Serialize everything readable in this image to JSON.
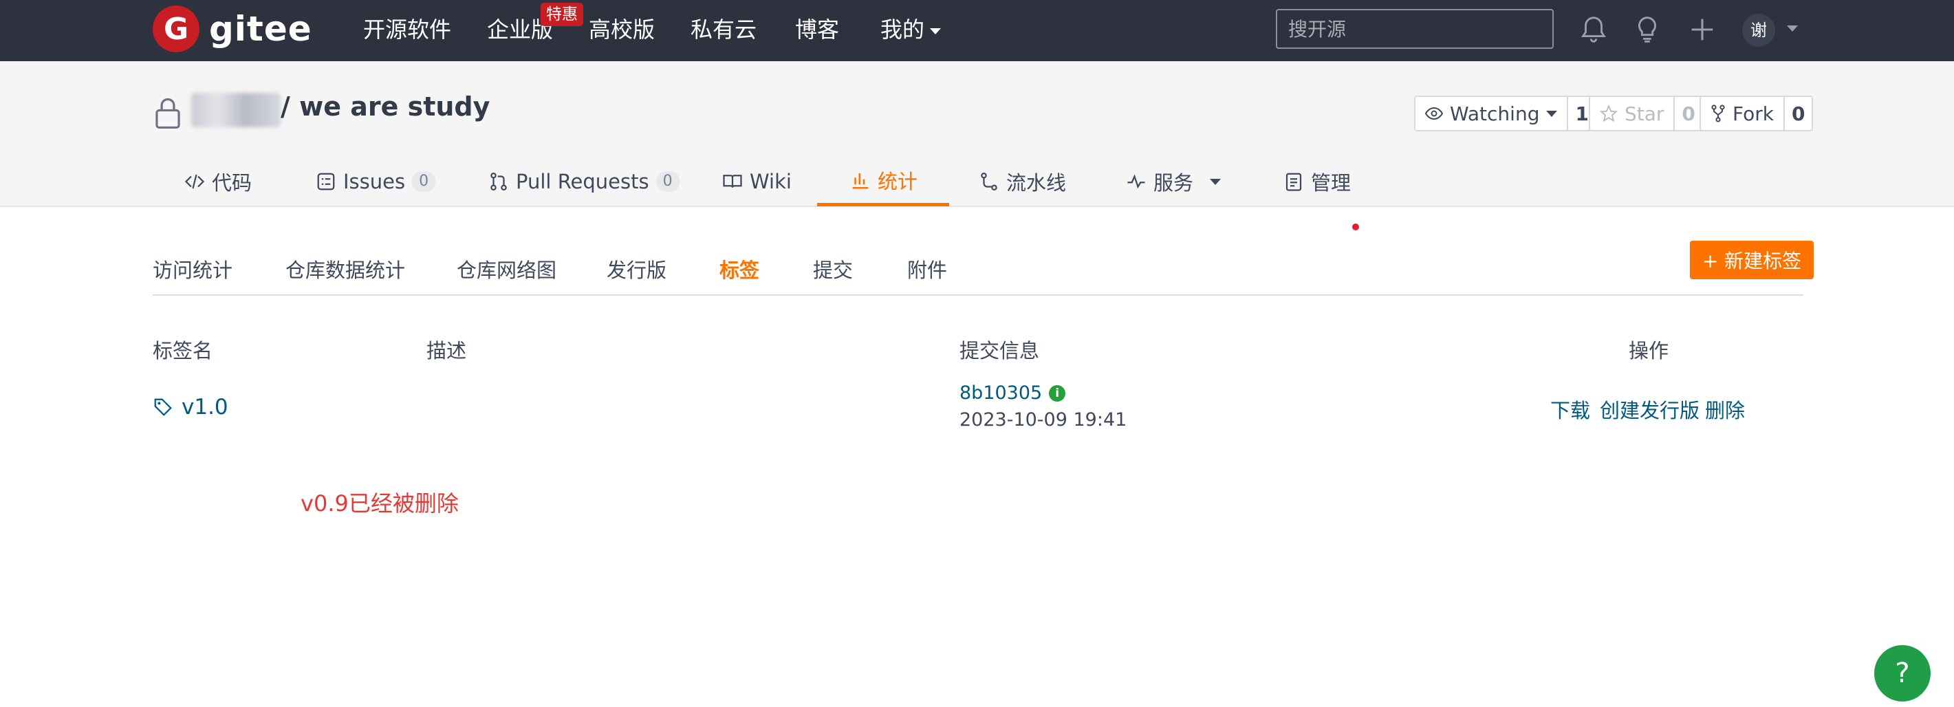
{
  "topnav": {
    "logo_text": "gitee",
    "items": [
      {
        "label": "开源软件"
      },
      {
        "label": "企业版",
        "badge": "特惠"
      },
      {
        "label": "高校版"
      },
      {
        "label": "私有云"
      },
      {
        "label": "博客"
      },
      {
        "label": "我的"
      }
    ],
    "search_placeholder": "搜开源",
    "avatar_initial": "谢",
    "icons": [
      "bell-icon",
      "lightbulb-icon",
      "plus-icon"
    ]
  },
  "repo": {
    "name": "/ we are study",
    "watch": {
      "label": "Watching",
      "count": "1"
    },
    "star": {
      "label": "Star",
      "count": "0"
    },
    "fork": {
      "label": "Fork",
      "count": "0"
    }
  },
  "tabs": [
    {
      "label": "代码",
      "icon": "code-icon"
    },
    {
      "label": "Issues",
      "count": "0",
      "icon": "issues-icon"
    },
    {
      "label": "Pull Requests",
      "count": "0",
      "icon": "pull-request-icon"
    },
    {
      "label": "Wiki",
      "icon": "book-icon"
    },
    {
      "label": "统计",
      "icon": "bar-chart-icon",
      "active": true
    },
    {
      "label": "流水线",
      "icon": "pipeline-icon"
    },
    {
      "label": "服务",
      "icon": "pulse-icon"
    },
    {
      "label": "管理",
      "icon": "clipboard-icon"
    }
  ],
  "subtabs": [
    {
      "label": "访问统计"
    },
    {
      "label": "仓库数据统计"
    },
    {
      "label": "仓库网络图"
    },
    {
      "label": "发行版"
    },
    {
      "label": "标签",
      "active": true
    },
    {
      "label": "提交"
    },
    {
      "label": "附件"
    }
  ],
  "new_tag_button": "+ 新建标签",
  "table": {
    "headers": [
      "标签名",
      "描述",
      "提交信息",
      "操作"
    ],
    "rows": [
      {
        "tag": "v1.0",
        "description": "",
        "commit_sha": "8b10305",
        "commit_date": "2023-10-09 19:41",
        "actions": [
          "下载",
          "创建发行版",
          "删除"
        ]
      }
    ]
  },
  "annotation": "v0.9已经被删除",
  "help_button": "?",
  "colors": {
    "accent": "#fe7300",
    "nav_bg": "#2e323e",
    "link": "#005980",
    "brand": "#c71d23",
    "annotation": "#e53935"
  }
}
